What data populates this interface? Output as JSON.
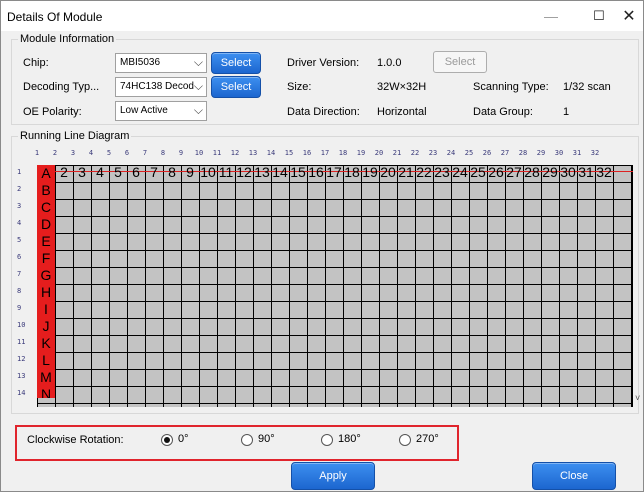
{
  "window": {
    "title": "Details Of Module",
    "min": "—",
    "max": "☐",
    "close": "✕"
  },
  "module_info": {
    "legend": "Module Information",
    "chip_label": "Chip:",
    "chip_value": "MBI5036",
    "decoding_label": "Decoding Typ...",
    "decoding_value": "74HC138 Decod",
    "oe_label": "OE Polarity:",
    "oe_value": "Low Active",
    "select_label": "Select",
    "driver_version_label": "Driver Version:",
    "driver_version_value": "1.0.0",
    "size_label": "Size:",
    "size_value": "32W×32H",
    "scanning_type_label": "Scanning Type:",
    "scanning_type_value": "1/32 scan",
    "data_direction_label": "Data Direction:",
    "data_direction_value": "Horizontal",
    "data_group_label": "Data Group:",
    "data_group_value": "1"
  },
  "diagram": {
    "legend": "Running Line Diagram",
    "column_numbers": [
      "1",
      "2",
      "3",
      "4",
      "5",
      "6",
      "7",
      "8",
      "9",
      "10",
      "11",
      "12",
      "13",
      "14",
      "15",
      "16",
      "17",
      "18",
      "19",
      "20",
      "21",
      "22",
      "23",
      "24",
      "25",
      "26",
      "27",
      "28",
      "29",
      "30",
      "31",
      "32"
    ],
    "row_numbers": [
      "1",
      "2",
      "3",
      "4",
      "5",
      "6",
      "7",
      "8",
      "9",
      "10",
      "11",
      "12",
      "13",
      "14"
    ],
    "row_labels": [
      "A",
      "B",
      "C",
      "D",
      "E",
      "F",
      "G",
      "H",
      "I",
      "J",
      "K",
      "L",
      "M",
      "N"
    ],
    "column_labels": [
      "2",
      "3",
      "4",
      "5",
      "6",
      "7",
      "8",
      "9",
      "10",
      "11",
      "12",
      "13",
      "14",
      "15",
      "16",
      "17",
      "18",
      "19",
      "20",
      "21",
      "22",
      "23",
      "24",
      "25",
      "26",
      "27",
      "28",
      "29",
      "30",
      "31",
      "32"
    ],
    "scroll_arrow": "˅"
  },
  "rotation": {
    "label": "Clockwise Rotation:",
    "options": [
      "0°",
      "90°",
      "180°",
      "270°"
    ],
    "selected": "0°"
  },
  "buttons": {
    "apply": "Apply",
    "close": "Close"
  },
  "colors": {
    "accent_blue": "#1c66cf",
    "highlight_red": "#e0242c",
    "cell_gray": "#c3c3c3",
    "label_red": "#e51d1d"
  }
}
